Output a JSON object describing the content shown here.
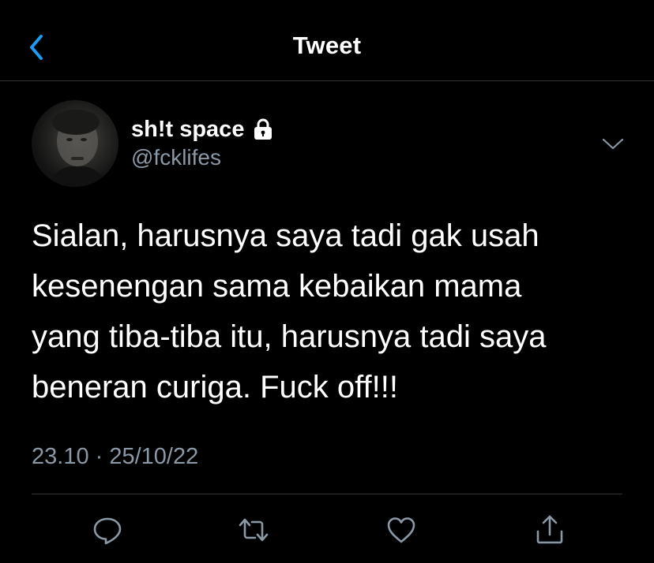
{
  "header": {
    "title": "Tweet",
    "back_icon": "chevron-left-icon",
    "accent_color": "#1d9bf0"
  },
  "tweet": {
    "author": {
      "display_name": "sh!t space",
      "handle": "@fcklifes",
      "protected_icon": "lock-icon"
    },
    "text": "Sialan, harusnya saya tadi gak usah\nkesenengan sama kebaikan mama\nyang tiba-tiba itu, harusnya tadi saya\nbeneran curiga. Fuck off!!!",
    "timestamp": "23.10 · 25/10/22"
  },
  "actions": [
    {
      "icon": "reply-icon"
    },
    {
      "icon": "retweet-icon"
    },
    {
      "icon": "like-icon"
    },
    {
      "icon": "share-icon"
    }
  ],
  "colors": {
    "background": "#000000",
    "text": "#ffffff",
    "secondary_text": "#8b98a5",
    "divider": "#2f3336"
  }
}
